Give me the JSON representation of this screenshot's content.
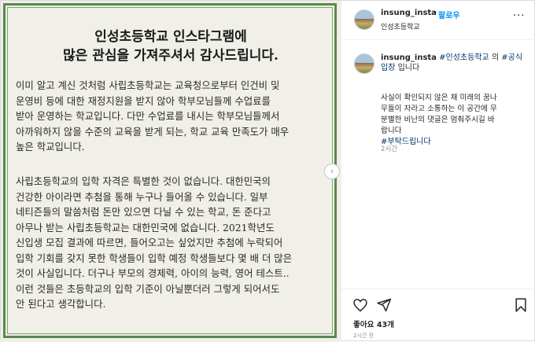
{
  "image": {
    "title_line1": "인성초등학교 인스타그램에",
    "title_line2": "많은 관심을 가져주셔서 감사드립니다.",
    "para1": [
      "  이미 알고 계신 것처럼 사립초등학교는 교육청으로부터 인건비 및",
      "운영비 등에 대한 재정지원을 받지 않아 학부모님들께 수업료를",
      "받아 운영하는 학교입니다. 다만 수업료를 내시는 학부모님들께서",
      "아까워하지 않을 수준의 교육을 받게 되는, 학교 교육 만족도가 매우",
      "높은 학교입니다."
    ],
    "para2": [
      "  사립초등학교의 입학 자격은 특별한 것이 없습니다. 대한민국의",
      "건강한 아이라면 추첨을 통해 누구나 들어올 수 있습니다. 일부",
      "네티즌들의 말씀처럼 돈만 있으면 다닐 수 있는 학교, 돈 준다고",
      "아무나 받는 사립초등학교는 대한민국에 없습니다. 2021학년도",
      "신입생 모집 결과에 따르면, 들어오고는 싶었지만 추첨에 누락되어",
      "입학 기회를 갖지 못한 학생들이 입학 예정 학생들보다 몇 배 더 많은",
      "것이 사실입니다. 더구나 부모의 경제력, 아이의 능력, 영어 테스트..",
      "이런 것들은 초등학교의 입학 기준이 아닐뿐더러 그렇게 되어서도",
      "안 된다고 생각합니다."
    ],
    "next_arrow": "›"
  },
  "header": {
    "username": "insung_insta",
    "separator": "•",
    "follow_label": "팔로우",
    "location": "인성초등학교",
    "more_icon": "···"
  },
  "caption": {
    "username": "insung_insta",
    "tag1": "#인성초등학교",
    "mid_text": " 의 ",
    "tag2": "#공식",
    "tag2b": "입장",
    "end_text": " 입니다",
    "body": [
      "사실이 확인되지 않은 채 미래의 꿈나",
      "무들이 자라고 소통하는 이 공간에 무",
      "분별한 비난의 댓글은 멈춰주시길 바",
      "랍니다"
    ],
    "tag3": "#부탁드립니다",
    "time": "2시간"
  },
  "footer": {
    "likes": "좋아요 43개",
    "time": "2시간 전"
  },
  "icons": [
    "heart-icon",
    "share-icon",
    "bookmark-icon",
    "more-icon"
  ]
}
